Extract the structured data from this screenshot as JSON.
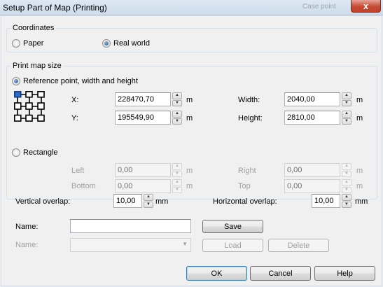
{
  "window": {
    "title": "Setup Part of Map (Printing)",
    "background_ghost_text": "Case point",
    "close_label": "x"
  },
  "coordinates": {
    "legend": "Coordinates",
    "paper_label": "Paper",
    "real_world_label": "Real world",
    "selected": "Real world"
  },
  "print_map_size": {
    "legend": "Print map size",
    "reference_option_label": "Reference point, width and height",
    "rectangle_option_label": "Rectangle",
    "selected": "Reference point, width and height",
    "reference": {
      "x_label": "X:",
      "x_value": "228470,70",
      "x_unit": "m",
      "y_label": "Y:",
      "y_value": "195549,90",
      "y_unit": "m",
      "width_label": "Width:",
      "width_value": "2040,00",
      "width_unit": "m",
      "height_label": "Height:",
      "height_value": "2810,00",
      "height_unit": "m"
    },
    "rectangle": {
      "left_label": "Left",
      "left_value": "0,00",
      "left_unit": "m",
      "bottom_label": "Bottom",
      "bottom_value": "0,00",
      "bottom_unit": "m",
      "right_label": "Right",
      "right_value": "0,00",
      "right_unit": "m",
      "top_label": "Top",
      "top_value": "0,00",
      "top_unit": "m"
    }
  },
  "overlap": {
    "vertical_label": "Vertical overlap:",
    "vertical_value": "10,00",
    "vertical_unit": "mm",
    "horizontal_label": "Horizontal overlap:",
    "horizontal_value": "10,00",
    "horizontal_unit": "mm"
  },
  "saved_settings": {
    "name_label": "Name:",
    "name_value": "",
    "save_label": "Save",
    "name_select_label": "Name:",
    "name_select_value": "",
    "load_label": "Load",
    "delete_label": "Delete"
  },
  "footer": {
    "ok_label": "OK",
    "cancel_label": "Cancel",
    "help_label": "Help"
  },
  "icons": {
    "spin_up": "▲",
    "spin_down": "▼",
    "combo_arrow": "▼"
  },
  "colors": {
    "accent": "#3c7fb1",
    "close_button": "#c74b33",
    "selected_anchor": "#2a6bc9"
  }
}
